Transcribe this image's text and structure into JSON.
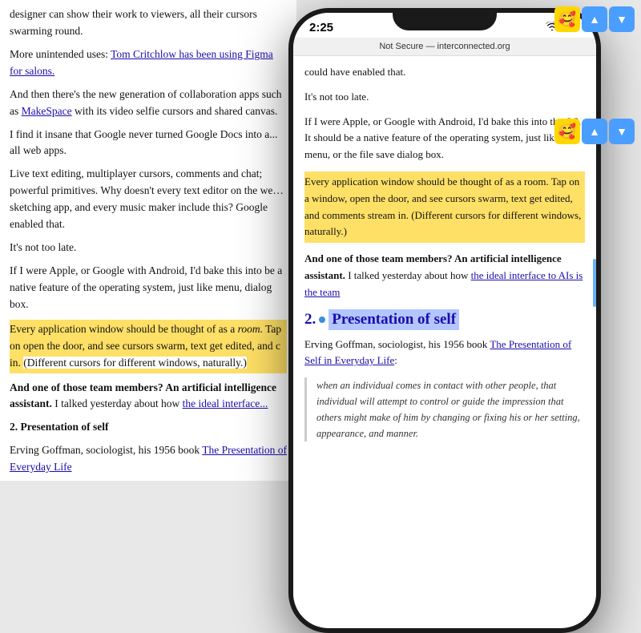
{
  "article": {
    "paragraphs": [
      {
        "id": "p1",
        "text": "designer can show their work to viewers, all their cursors swarming round."
      },
      {
        "id": "p2",
        "prefix": "More unintended uses: ",
        "link_text": "Tom Critchlow has been using Figma for salons.",
        "suffix": ""
      },
      {
        "id": "p3",
        "text": "And then there's the new generation of collaboration apps such as",
        "link_text": "MakeSpace",
        "suffix": " with its video selfie cursors and shared canvas."
      },
      {
        "id": "p4",
        "text": "I find it insane that Google never turned Google Docs into a... all web apps."
      },
      {
        "id": "p5",
        "text": "Live text editing, multiplayer cursors, comments and chat; powerful primitives. Why doesn't every text editor on the web, sketching app, and every music maker include this? Google enabled that."
      },
      {
        "id": "p6",
        "text": "It's not too late."
      },
      {
        "id": "p7",
        "text": "If I were Apple, or Google with Android, I'd bake this into be a native feature of the operating system, just like menu, dialog box."
      },
      {
        "id": "p8",
        "highlighted_text": "Every application window should be thought of as a room. Tap on open the door, and see cursors swarm, text get edited, and c in.",
        "suffix": " (Different cursors for different windows, naturally.)"
      },
      {
        "id": "p9",
        "bold_prefix": "And one of those team members? An artificial intelligence assistant.",
        "suffix": " I talked yesterday about how ",
        "link_text": "the ideal interface..."
      }
    ],
    "section_heading": "2. Presentation of self",
    "section_body": "Erving Goffman, sociologist, his 1956 book ",
    "section_link": "The Presentation of Everyday Life"
  },
  "phone": {
    "status_bar": {
      "time": "2:25",
      "signal": "●●●",
      "wifi": "wifi",
      "battery": "battery"
    },
    "browser_bar": {
      "security": "Not Secure —",
      "url": "interconnected.org"
    },
    "content": {
      "p1": "could have enabled that.",
      "p2": "It's not too late.",
      "p3": "If I were Apple, or Google with Android, I'd bake this into the OS. It should be a native feature of the operating system, just like menu, or the file save dialog box.",
      "highlighted_block": "Every application window should be thought of as a room. Tap on a window, open the door, and see cursors swarm, text get edited, and comments stream in.",
      "highlighted_suffix": " (Different cursors for different windows, naturally.)",
      "bold_text": "And one of those team members? An artificial intelligence assistant.",
      "p4_suffix": " I talked yesterday about how ",
      "p4_link": "the ideal interface to AIs is the team",
      "section_number": "2.",
      "section_title": "Presentation of self",
      "section_body_prefix": "Erving Goffman, sociologist, his 1956 book ",
      "section_link": "The Presentation of Self in Everyday Life",
      "section_body_suffix": ":",
      "blockquote": "when an individual comes in contact with other people, that individual will attempt to control or guide the impression that others might make of him by changing or fixing his or her setting, appearance, and manner."
    }
  },
  "emoji_top": {
    "face": "🥰",
    "up": "▲",
    "down": "▼"
  },
  "emoji_mid": {
    "face": "🥰",
    "up": "▲",
    "down": "▼"
  }
}
